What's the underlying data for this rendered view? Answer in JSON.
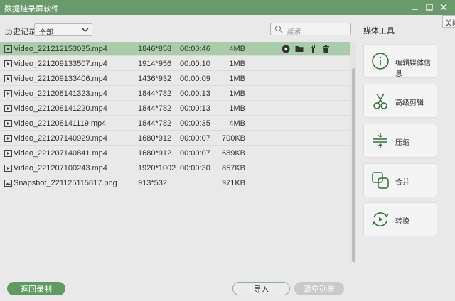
{
  "window": {
    "title": "数据蛙录屏软件",
    "close_tooltip": "关闭"
  },
  "filter": {
    "history_label": "历史记录",
    "select_value": "全部",
    "search_placeholder": "搜索"
  },
  "files": [
    {
      "name": "Video_221212153035.mp4",
      "resolution": "1846*858",
      "duration": "00:00:46",
      "size": "4MB",
      "type": "video",
      "selected": true
    },
    {
      "name": "Video_221209133507.mp4",
      "resolution": "1914*956",
      "duration": "00:00:10",
      "size": "1MB",
      "type": "video"
    },
    {
      "name": "Video_221209133406.mp4",
      "resolution": "1436*932",
      "duration": "00:00:09",
      "size": "1MB",
      "type": "video"
    },
    {
      "name": "Video_221208141323.mp4",
      "resolution": "1844*782",
      "duration": "00:00:13",
      "size": "1MB",
      "type": "video"
    },
    {
      "name": "Video_221208141220.mp4",
      "resolution": "1844*782",
      "duration": "00:00:13",
      "size": "1MB",
      "type": "video"
    },
    {
      "name": "Video_221208141119.mp4",
      "resolution": "1844*782",
      "duration": "00:00:35",
      "size": "4MB",
      "type": "video"
    },
    {
      "name": "Video_221207140929.mp4",
      "resolution": "1680*912",
      "duration": "00:00:07",
      "size": "700KB",
      "type": "video"
    },
    {
      "name": "Video_221207140841.mp4",
      "resolution": "1680*912",
      "duration": "00:00:07",
      "size": "689KB",
      "type": "video"
    },
    {
      "name": "Video_221207100243.mp4",
      "resolution": "1920*1002",
      "duration": "00:00:30",
      "size": "857KB",
      "type": "video"
    },
    {
      "name": "Snapshot_221125115817.png",
      "resolution": "913*532",
      "duration": "",
      "size": "971KB",
      "type": "image"
    }
  ],
  "sidebar": {
    "title": "媒体工具",
    "tools": [
      {
        "label": "编辑媒体信息",
        "icon": "info-icon"
      },
      {
        "label": "高级剪辑",
        "icon": "scissors-icon"
      },
      {
        "label": "压缩",
        "icon": "compress-icon"
      },
      {
        "label": "合并",
        "icon": "merge-icon"
      },
      {
        "label": "转换",
        "icon": "convert-icon"
      }
    ]
  },
  "buttons": {
    "back": "返回录制",
    "import": "导入",
    "clear": "清空列表"
  },
  "colors": {
    "accent": "#6a9a6c",
    "selected_row": "#a9cda9",
    "button_green": "#5f9a61"
  }
}
